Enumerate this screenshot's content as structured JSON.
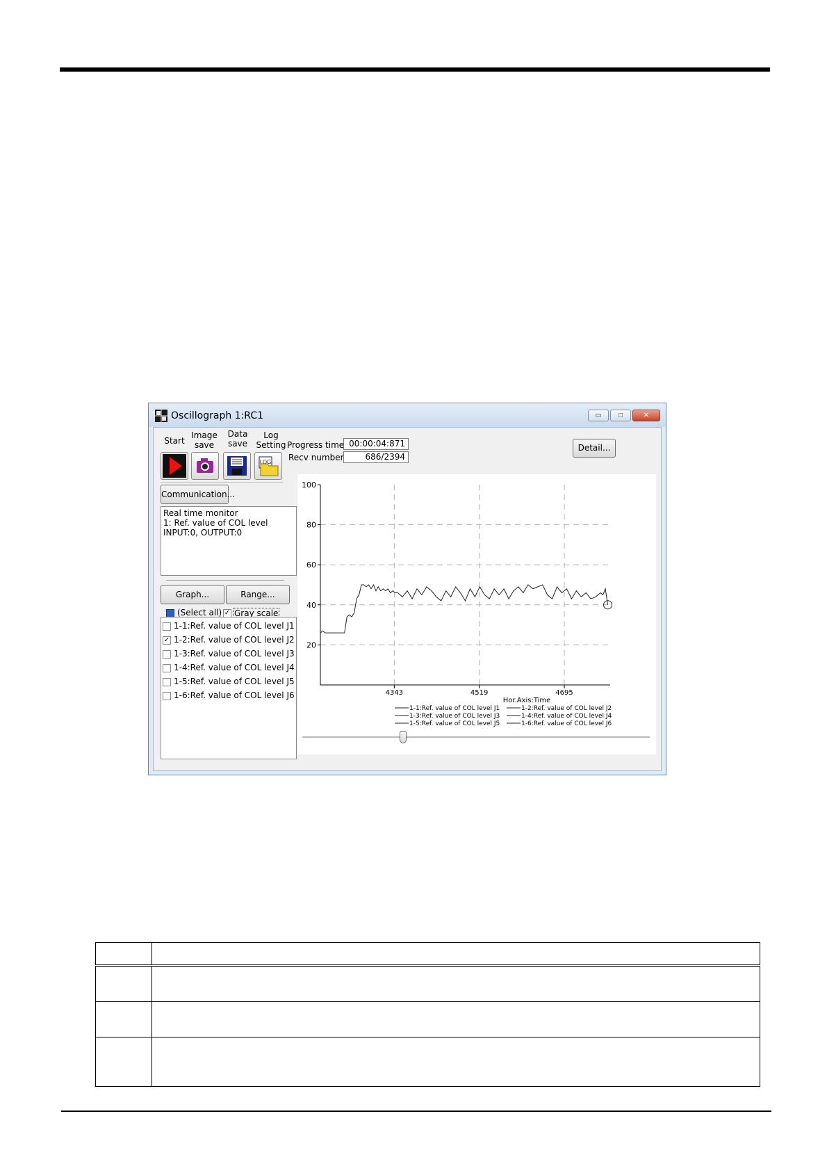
{
  "window": {
    "title": "Oscillograph 1:RC1",
    "buttons": {
      "minimize": "▭",
      "maximize": "□",
      "close": "✕"
    }
  },
  "toolbar": {
    "start_label": "Start",
    "image_save_label": [
      "Image",
      "save"
    ],
    "data_save_label": [
      "Data",
      "save"
    ],
    "log_setting_label": [
      "Log",
      "Setting"
    ],
    "log_icon_text": "LOG",
    "icons": {
      "start": "play-icon",
      "image_save": "camera-icon",
      "data_save": "floppy-disk-icon",
      "log": "log-folder-icon"
    }
  },
  "progress": {
    "progress_time_label": "Progress time:",
    "progress_time_value": "00:00:04:871",
    "recv_number_label": "Recv number:",
    "recv_number_value": "686/2394"
  },
  "detail_button": "Detail...",
  "communication_button": "Communication...",
  "monitor": {
    "lines": [
      "Real time monitor",
      "1: Ref. value of COL level",
      "INPUT:0, OUTPUT:0"
    ]
  },
  "graph_button": "Graph...",
  "range_button": "Range...",
  "select_all": {
    "label": "(Select all)",
    "checked": false
  },
  "gray_scale": {
    "label": "Gray scale",
    "checked": true
  },
  "signals": [
    {
      "label": "1-1:Ref. value of COL level J1",
      "checked": false
    },
    {
      "label": "1-2:Ref. value of COL level J2",
      "checked": true
    },
    {
      "label": "1-3:Ref. value of COL level J3",
      "checked": false
    },
    {
      "label": "1-4:Ref. value of COL level J4",
      "checked": false
    },
    {
      "label": "1-5:Ref. value of COL level J5",
      "checked": false
    },
    {
      "label": "1-6:Ref. value of COL level J6",
      "checked": false
    }
  ],
  "slider": {
    "position_fraction": 0.29
  },
  "chart_data": {
    "type": "line",
    "title": "",
    "xlabel": "Hor.Axis:Time",
    "ylabel": "",
    "ylim": [
      0,
      100
    ],
    "xlim": [
      4190,
      4790
    ],
    "y_ticks": [
      "100",
      "80",
      "60",
      "40",
      "20"
    ],
    "x_ticks": [
      "4343",
      "4519",
      "4695"
    ],
    "x_tick_values": [
      4343,
      4519,
      4695
    ],
    "grid": true,
    "legend": [
      "1-1:Ref. value of COL level J1",
      "1-2:Ref. value of COL level J2",
      "1-3:Ref. value of COL level J3",
      "1-4:Ref. value of COL level J4",
      "1-5:Ref. value of COL level J5",
      "1-6:Ref. value of COL level J6"
    ],
    "legend_position": "bottom-right",
    "series": [
      {
        "x": [
          4190,
          4195,
          4200,
          4205,
          4210,
          4215,
          4220,
          4225,
          4230,
          4235,
          4240,
          4245,
          4250,
          4255,
          4260,
          4265,
          4270,
          4275,
          4280,
          4285,
          4290,
          4295,
          4300,
          4305,
          4310,
          4315,
          4320,
          4325,
          4330,
          4335,
          4340,
          4345,
          4350,
          4360,
          4370,
          4380,
          4390,
          4400,
          4410,
          4420,
          4430,
          4440,
          4450,
          4460,
          4470,
          4480,
          4490,
          4500,
          4510,
          4520,
          4530,
          4540,
          4550,
          4560,
          4570,
          4580,
          4590,
          4600,
          4610,
          4620,
          4630,
          4640,
          4650,
          4660,
          4670,
          4680,
          4690,
          4700,
          4710,
          4720,
          4730,
          4740,
          4750,
          4760,
          4770,
          4775,
          4780,
          4785
        ],
        "values": [
          26,
          27,
          26,
          26,
          26,
          26,
          26,
          26,
          26,
          26,
          26,
          34,
          35,
          34,
          36,
          43,
          45,
          50,
          50,
          49,
          50,
          48,
          50,
          47,
          49,
          47,
          48,
          47,
          48,
          46,
          47,
          46,
          46,
          44,
          47,
          43,
          48,
          45,
          49,
          47,
          44,
          42,
          47,
          44,
          49,
          46,
          42,
          48,
          44,
          49,
          45,
          43,
          48,
          45,
          48,
          43,
          47,
          49,
          46,
          50,
          48,
          49,
          50,
          45,
          43,
          49,
          46,
          48,
          43,
          47,
          44,
          46,
          43,
          44,
          46,
          45,
          48,
          40
        ]
      }
    ]
  }
}
